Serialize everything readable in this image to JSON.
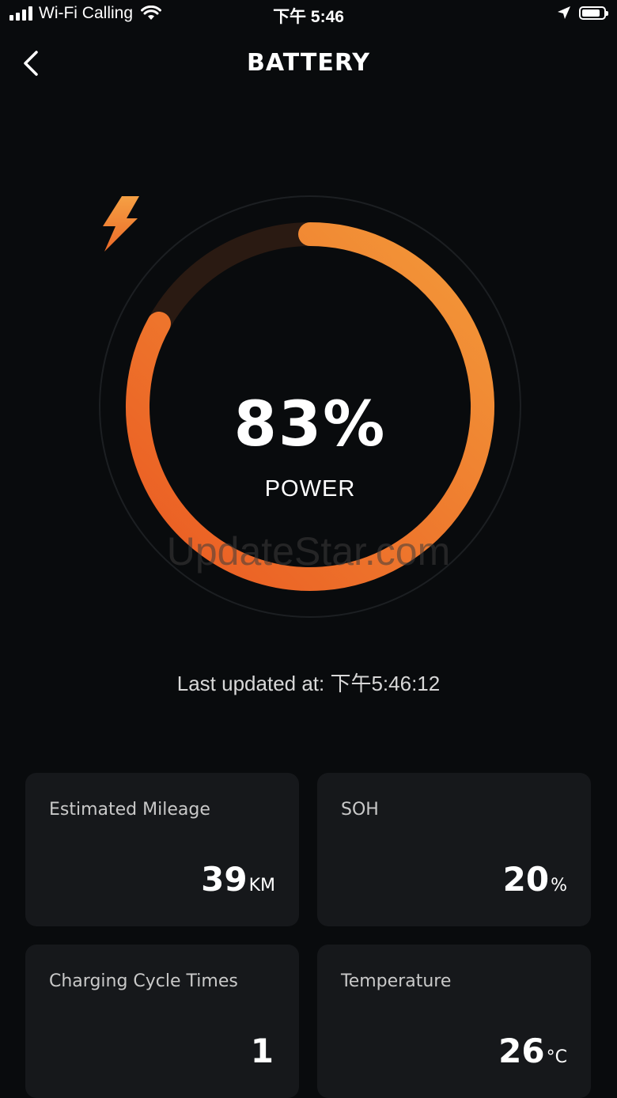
{
  "status_bar": {
    "carrier": "Wi-Fi Calling",
    "time": "下午 5:46"
  },
  "header": {
    "title": "BATTERY",
    "back_icon": "chevron-left-icon"
  },
  "gauge": {
    "percent_text": "83%",
    "label": "POWER",
    "level": 0.83,
    "icon": "lightning-bolt-icon",
    "colors": {
      "start": "#f39a3a",
      "end": "#ea5a22",
      "track": "#2a1a12"
    }
  },
  "watermark": "UpdateStar.com",
  "last_updated": "Last updated at: 下午5:46:12",
  "cards": [
    {
      "label": "Estimated Mileage",
      "value": "39",
      "unit": "KM"
    },
    {
      "label": "SOH",
      "value": "20",
      "unit": "%"
    },
    {
      "label": "Charging Cycle Times",
      "value": "1",
      "unit": ""
    },
    {
      "label": "Temperature",
      "value": "26",
      "unit": "°C"
    }
  ]
}
